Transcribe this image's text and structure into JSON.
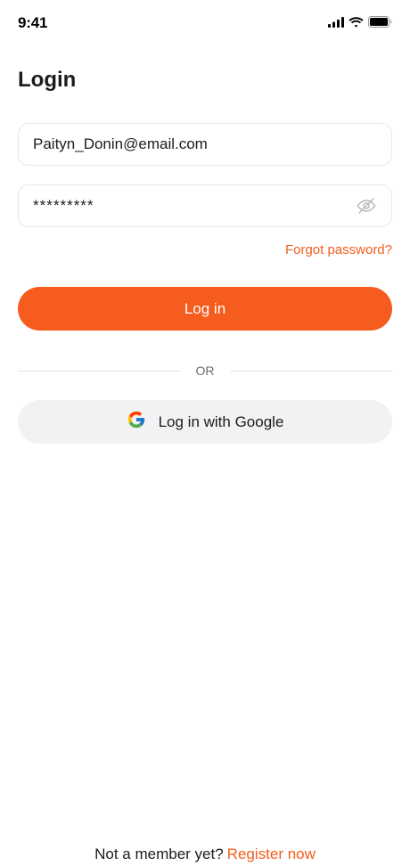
{
  "status_bar": {
    "time": "9:41",
    "icons": [
      "cellular-signal-icon",
      "wifi-icon",
      "battery-icon"
    ]
  },
  "page": {
    "title": "Login"
  },
  "form": {
    "email_value": "Paityn_Donin@email.com",
    "password_value": "*********",
    "password_toggle_icon": "eye-off-icon",
    "forgot_password": "Forgot password?",
    "login_button": "Log in",
    "divider_text": "OR",
    "google_button": "Log in with Google",
    "google_icon": "google-icon"
  },
  "footer": {
    "prompt": "Not a member yet?",
    "register_link": "Register now"
  },
  "colors": {
    "accent": "#F55C1E",
    "link": "#F45D1D",
    "secondary_button": "#F2F2F5",
    "border": "#E6E6EA"
  }
}
